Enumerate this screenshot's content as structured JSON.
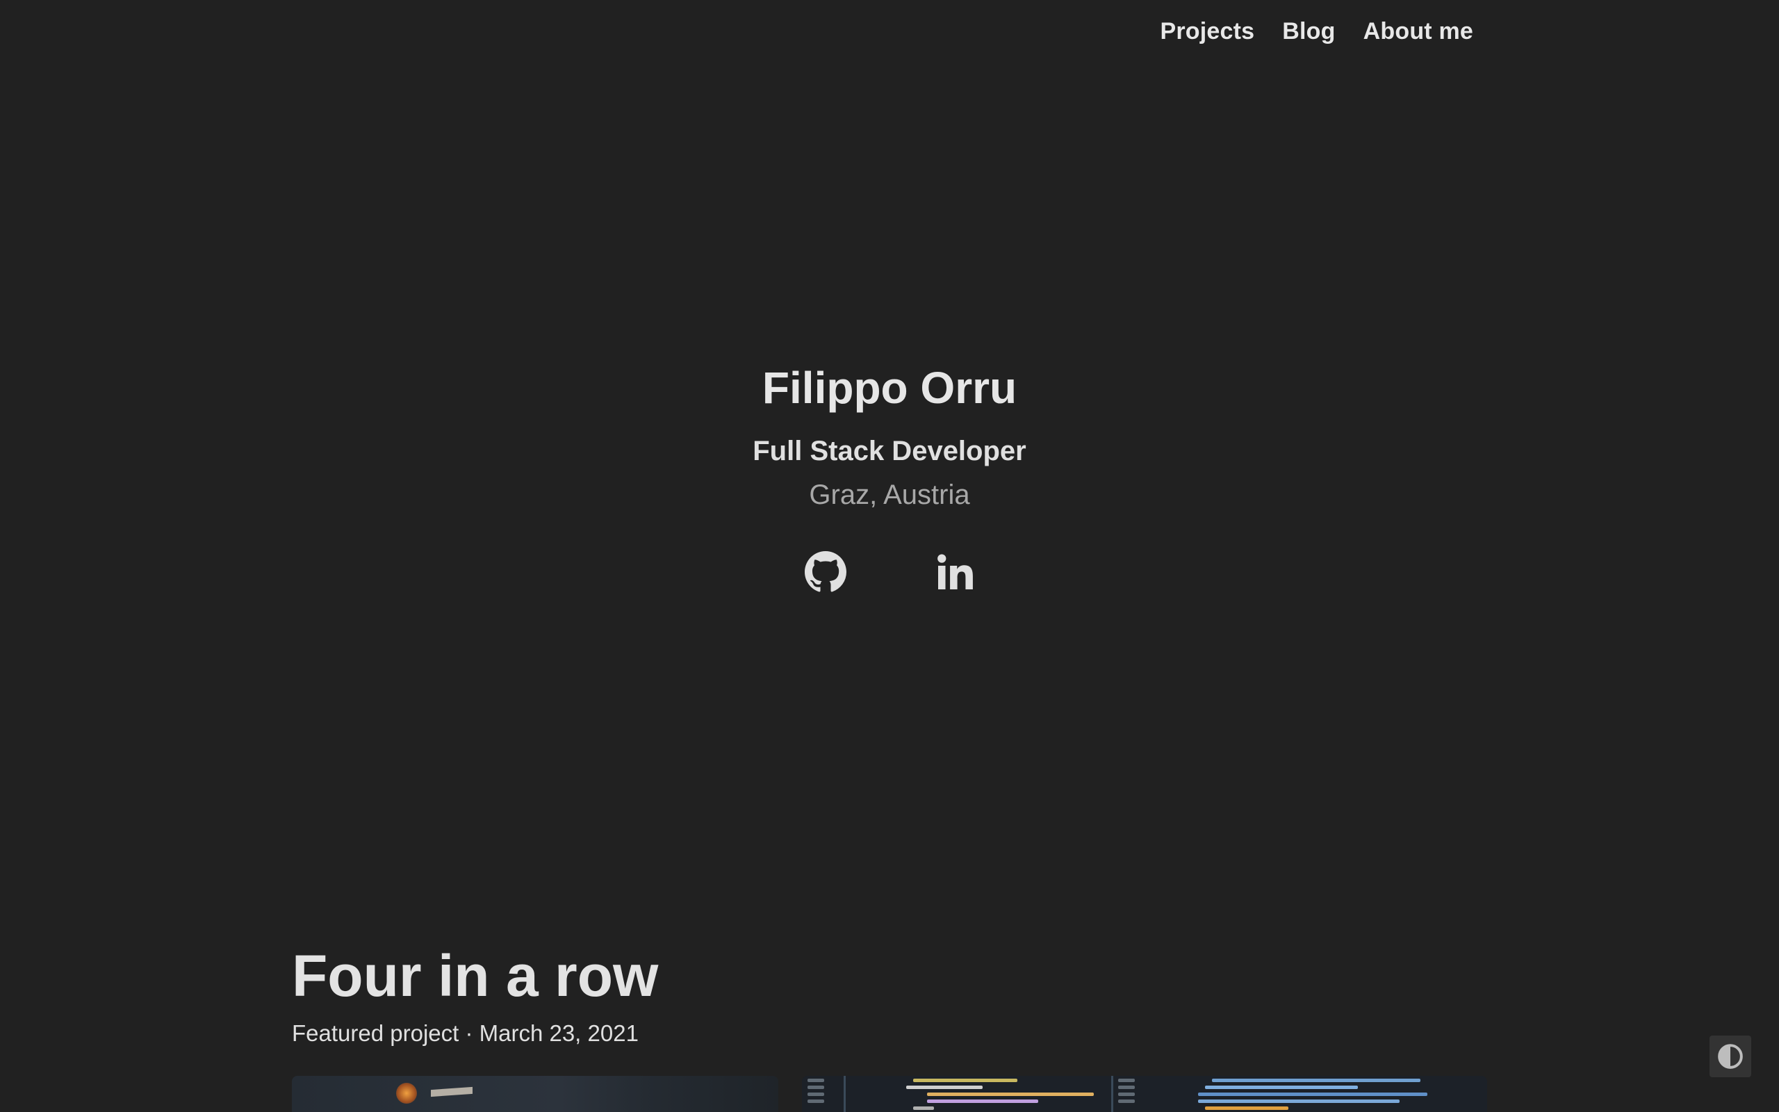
{
  "nav": {
    "items": [
      {
        "label": "Projects"
      },
      {
        "label": "Blog"
      },
      {
        "label": "About me"
      }
    ]
  },
  "hero": {
    "name": "Filippo Orru",
    "role": "Full Stack Developer",
    "location": "Graz, Austria",
    "socials": [
      {
        "icon": "github-icon"
      },
      {
        "icon": "linkedin-icon"
      }
    ]
  },
  "featured": {
    "title": "Four in a row",
    "meta": "Featured project · March 23, 2021"
  },
  "theme_toggle": {
    "icon": "half-circle-contrast-icon"
  },
  "colors": {
    "background": "#212121",
    "text": "#e6e6e6",
    "muted": "#a8a8a8"
  }
}
